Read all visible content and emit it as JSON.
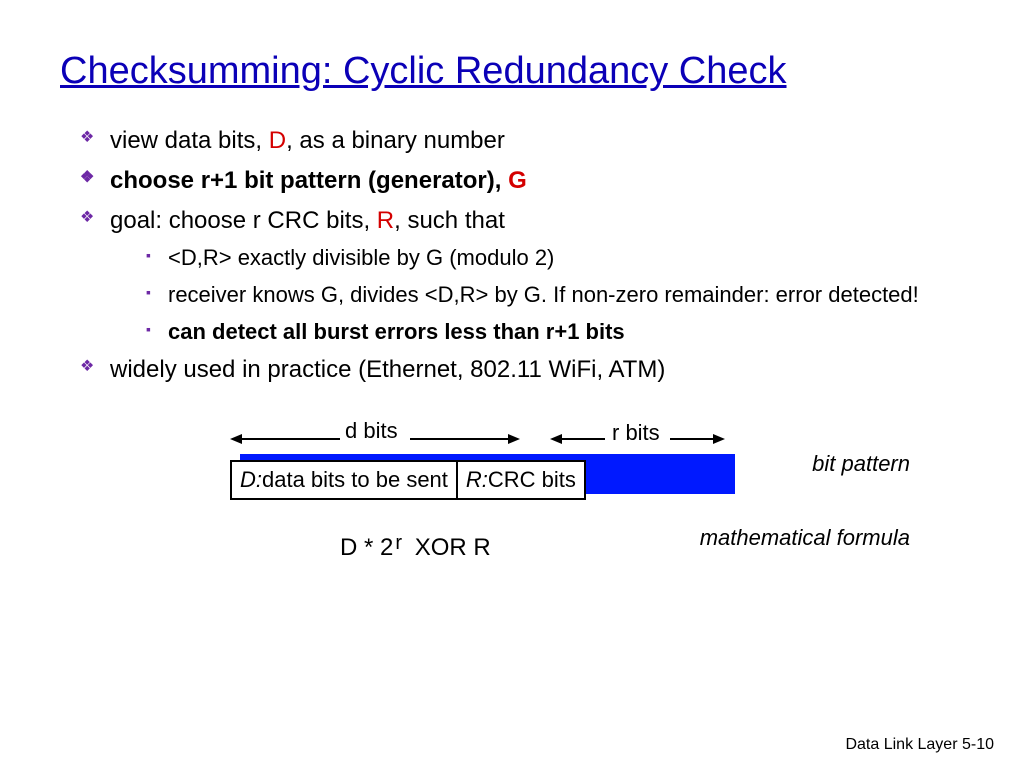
{
  "title": "Checksumming: Cyclic Redundancy Check",
  "bullets": {
    "b1_a": "view data bits, ",
    "b1_D": "D",
    "b1_b": ", as a binary number",
    "b2_a": "choose r+1 bit pattern (generator), ",
    "b2_G": "G",
    "b3_a": "goal: choose r CRC bits, ",
    "b3_R": "R",
    "b3_b": ", such that",
    "s1": "<D,R> exactly divisible by G (modulo 2)",
    "s2": "receiver knows G, divides <D,R> by G.  If non-zero remainder: error detected!",
    "s3": "can detect all burst errors less than r+1 bits",
    "b4": "widely used in practice (Ethernet, 802.11 WiFi, ATM)"
  },
  "diagram": {
    "d_bits": "d bits",
    "r_bits": "r bits",
    "D_prefix": "D:",
    "D_text": " data bits to be sent",
    "R_prefix": "R:",
    "R_text": " CRC bits",
    "bit_pattern": "bit pattern",
    "formula": "D * 2",
    "formula_sup": "r",
    "formula_rest": "   XOR   R",
    "math_label": "mathematical formula"
  },
  "footer": "Data Link Layer  5-10"
}
